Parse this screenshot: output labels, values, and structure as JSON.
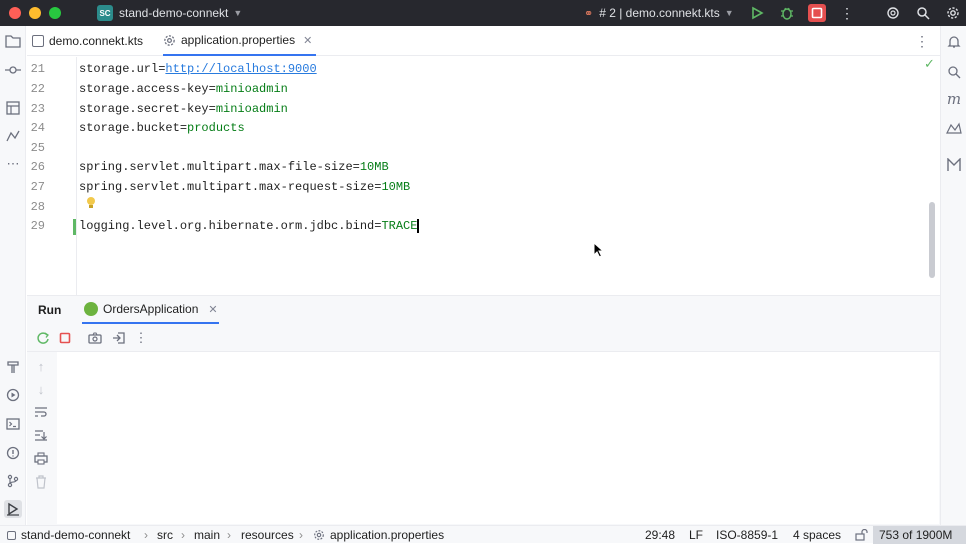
{
  "titlebar": {
    "project_badge": "SC",
    "project_name": "stand-demo-connekt",
    "run_config": "# 2 | demo.connekt.kts",
    "colors": {
      "close": "#ff5f57",
      "minimize": "#febc2e",
      "zoom": "#28c840",
      "stop_active": "#e55050"
    }
  },
  "tabs": [
    {
      "label": "demo.connekt.kts",
      "icon": "kotlin-script-icon"
    },
    {
      "label": "application.properties",
      "icon": "gear-icon"
    }
  ],
  "editor": {
    "lines": [
      {
        "num": "21",
        "key": "storage.url=",
        "value": "http://localhost:9000"
      },
      {
        "num": "22",
        "key": "storage.access-key=",
        "value": "minioadmin"
      },
      {
        "num": "23",
        "key": "storage.secret-key=",
        "value": "minioadmin"
      },
      {
        "num": "24",
        "key": "storage.bucket=",
        "value": "products"
      },
      {
        "num": "25",
        "key": "",
        "value": ""
      },
      {
        "num": "26",
        "key": "spring.servlet.multipart.max-file-size=",
        "value": "10MB"
      },
      {
        "num": "27",
        "key": "spring.servlet.multipart.max-request-size=",
        "value": "10MB"
      },
      {
        "num": "28",
        "key": "",
        "value": ""
      },
      {
        "num": "29",
        "key": "logging.level.org.hibernate.orm.jdbc.bind=",
        "value": "TRACE"
      }
    ]
  },
  "run_panel": {
    "title": "Run",
    "tab_label": "OrdersApplication"
  },
  "status_bar": {
    "breadcrumb": [
      "stand-demo-connekt",
      "src",
      "main",
      "resources",
      "application.properties"
    ],
    "position": "29:48",
    "line_sep": "LF",
    "encoding": "ISO-8859-1",
    "indent": "4 spaces",
    "memory": "753 of 1900M"
  }
}
